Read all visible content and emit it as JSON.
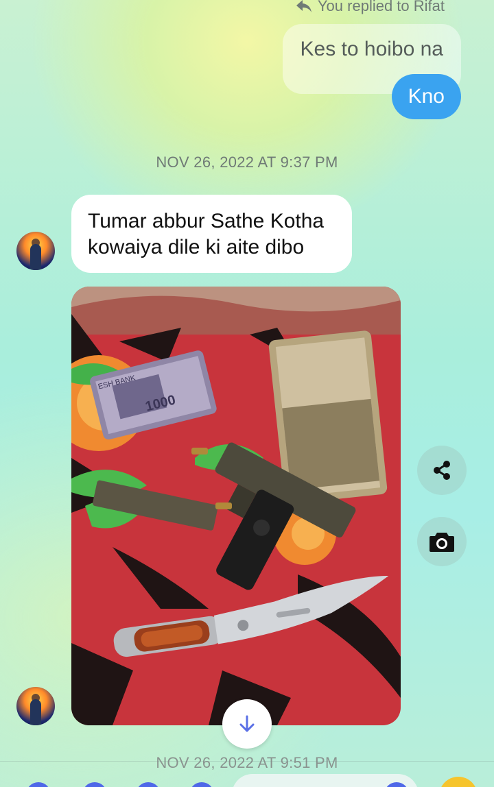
{
  "reply_meta": {
    "text": "You replied to Rifat",
    "icon": "reply-icon"
  },
  "replied_message": {
    "text": "Kes to hoibo na"
  },
  "my_message": {
    "text": "Kno"
  },
  "timestamps": [
    "NOV 26, 2022 AT 9:37 PM",
    "NOV 26, 2022 AT 9:51 PM"
  ],
  "their_message": {
    "text": "Tumar abbur Sathe Kotha kowaiya dile ki aite dibo"
  },
  "photo": {
    "banknote_text": "1000",
    "banknote_bank": "ESH BANK"
  },
  "actions": {
    "share_icon": "share-icon",
    "camera_icon": "camera-icon",
    "scroll_icon": "arrow-down-icon"
  },
  "colors": {
    "my_bubble": "#3aa3f0",
    "their_bubble": "#ffffff",
    "accent": "#4f68e8"
  }
}
